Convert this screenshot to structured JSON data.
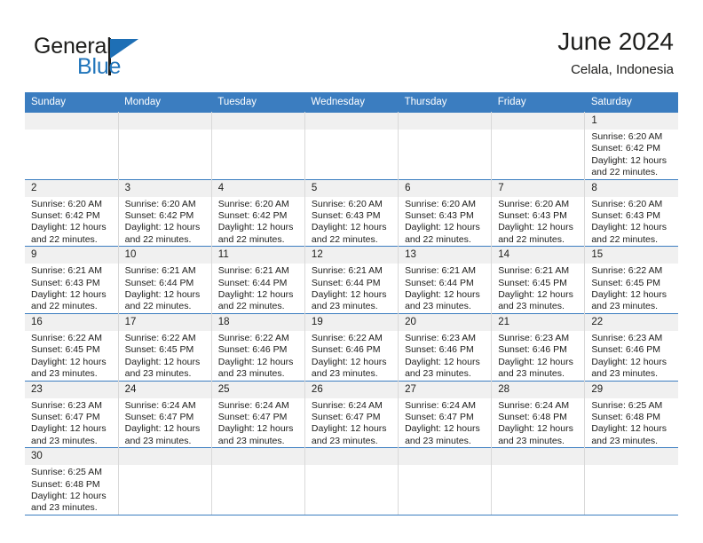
{
  "brand": {
    "name_top": "General",
    "name_bottom": "Blue",
    "accent_color": "#2175bb"
  },
  "header": {
    "title": "June 2024",
    "subtitle": "Celala, Indonesia"
  },
  "calendar": {
    "header_bg": "#3b7dc0",
    "daynum_bg": "#f0f0f0",
    "weekdays": [
      "Sunday",
      "Monday",
      "Tuesday",
      "Wednesday",
      "Thursday",
      "Friday",
      "Saturday"
    ],
    "labels": {
      "sunrise": "Sunrise:",
      "sunset": "Sunset:",
      "daylight": "Daylight:"
    },
    "weeks": [
      [
        {
          "day": ""
        },
        {
          "day": ""
        },
        {
          "day": ""
        },
        {
          "day": ""
        },
        {
          "day": ""
        },
        {
          "day": ""
        },
        {
          "day": "1",
          "sunrise": "Sunrise: 6:20 AM",
          "sunset": "Sunset: 6:42 PM",
          "daylight_1": "Daylight: 12 hours",
          "daylight_2": "and 22 minutes."
        }
      ],
      [
        {
          "day": "2",
          "sunrise": "Sunrise: 6:20 AM",
          "sunset": "Sunset: 6:42 PM",
          "daylight_1": "Daylight: 12 hours",
          "daylight_2": "and 22 minutes."
        },
        {
          "day": "3",
          "sunrise": "Sunrise: 6:20 AM",
          "sunset": "Sunset: 6:42 PM",
          "daylight_1": "Daylight: 12 hours",
          "daylight_2": "and 22 minutes."
        },
        {
          "day": "4",
          "sunrise": "Sunrise: 6:20 AM",
          "sunset": "Sunset: 6:42 PM",
          "daylight_1": "Daylight: 12 hours",
          "daylight_2": "and 22 minutes."
        },
        {
          "day": "5",
          "sunrise": "Sunrise: 6:20 AM",
          "sunset": "Sunset: 6:43 PM",
          "daylight_1": "Daylight: 12 hours",
          "daylight_2": "and 22 minutes."
        },
        {
          "day": "6",
          "sunrise": "Sunrise: 6:20 AM",
          "sunset": "Sunset: 6:43 PM",
          "daylight_1": "Daylight: 12 hours",
          "daylight_2": "and 22 minutes."
        },
        {
          "day": "7",
          "sunrise": "Sunrise: 6:20 AM",
          "sunset": "Sunset: 6:43 PM",
          "daylight_1": "Daylight: 12 hours",
          "daylight_2": "and 22 minutes."
        },
        {
          "day": "8",
          "sunrise": "Sunrise: 6:20 AM",
          "sunset": "Sunset: 6:43 PM",
          "daylight_1": "Daylight: 12 hours",
          "daylight_2": "and 22 minutes."
        }
      ],
      [
        {
          "day": "9",
          "sunrise": "Sunrise: 6:21 AM",
          "sunset": "Sunset: 6:43 PM",
          "daylight_1": "Daylight: 12 hours",
          "daylight_2": "and 22 minutes."
        },
        {
          "day": "10",
          "sunrise": "Sunrise: 6:21 AM",
          "sunset": "Sunset: 6:44 PM",
          "daylight_1": "Daylight: 12 hours",
          "daylight_2": "and 22 minutes."
        },
        {
          "day": "11",
          "sunrise": "Sunrise: 6:21 AM",
          "sunset": "Sunset: 6:44 PM",
          "daylight_1": "Daylight: 12 hours",
          "daylight_2": "and 22 minutes."
        },
        {
          "day": "12",
          "sunrise": "Sunrise: 6:21 AM",
          "sunset": "Sunset: 6:44 PM",
          "daylight_1": "Daylight: 12 hours",
          "daylight_2": "and 23 minutes."
        },
        {
          "day": "13",
          "sunrise": "Sunrise: 6:21 AM",
          "sunset": "Sunset: 6:44 PM",
          "daylight_1": "Daylight: 12 hours",
          "daylight_2": "and 23 minutes."
        },
        {
          "day": "14",
          "sunrise": "Sunrise: 6:21 AM",
          "sunset": "Sunset: 6:45 PM",
          "daylight_1": "Daylight: 12 hours",
          "daylight_2": "and 23 minutes."
        },
        {
          "day": "15",
          "sunrise": "Sunrise: 6:22 AM",
          "sunset": "Sunset: 6:45 PM",
          "daylight_1": "Daylight: 12 hours",
          "daylight_2": "and 23 minutes."
        }
      ],
      [
        {
          "day": "16",
          "sunrise": "Sunrise: 6:22 AM",
          "sunset": "Sunset: 6:45 PM",
          "daylight_1": "Daylight: 12 hours",
          "daylight_2": "and 23 minutes."
        },
        {
          "day": "17",
          "sunrise": "Sunrise: 6:22 AM",
          "sunset": "Sunset: 6:45 PM",
          "daylight_1": "Daylight: 12 hours",
          "daylight_2": "and 23 minutes."
        },
        {
          "day": "18",
          "sunrise": "Sunrise: 6:22 AM",
          "sunset": "Sunset: 6:46 PM",
          "daylight_1": "Daylight: 12 hours",
          "daylight_2": "and 23 minutes."
        },
        {
          "day": "19",
          "sunrise": "Sunrise: 6:22 AM",
          "sunset": "Sunset: 6:46 PM",
          "daylight_1": "Daylight: 12 hours",
          "daylight_2": "and 23 minutes."
        },
        {
          "day": "20",
          "sunrise": "Sunrise: 6:23 AM",
          "sunset": "Sunset: 6:46 PM",
          "daylight_1": "Daylight: 12 hours",
          "daylight_2": "and 23 minutes."
        },
        {
          "day": "21",
          "sunrise": "Sunrise: 6:23 AM",
          "sunset": "Sunset: 6:46 PM",
          "daylight_1": "Daylight: 12 hours",
          "daylight_2": "and 23 minutes."
        },
        {
          "day": "22",
          "sunrise": "Sunrise: 6:23 AM",
          "sunset": "Sunset: 6:46 PM",
          "daylight_1": "Daylight: 12 hours",
          "daylight_2": "and 23 minutes."
        }
      ],
      [
        {
          "day": "23",
          "sunrise": "Sunrise: 6:23 AM",
          "sunset": "Sunset: 6:47 PM",
          "daylight_1": "Daylight: 12 hours",
          "daylight_2": "and 23 minutes."
        },
        {
          "day": "24",
          "sunrise": "Sunrise: 6:24 AM",
          "sunset": "Sunset: 6:47 PM",
          "daylight_1": "Daylight: 12 hours",
          "daylight_2": "and 23 minutes."
        },
        {
          "day": "25",
          "sunrise": "Sunrise: 6:24 AM",
          "sunset": "Sunset: 6:47 PM",
          "daylight_1": "Daylight: 12 hours",
          "daylight_2": "and 23 minutes."
        },
        {
          "day": "26",
          "sunrise": "Sunrise: 6:24 AM",
          "sunset": "Sunset: 6:47 PM",
          "daylight_1": "Daylight: 12 hours",
          "daylight_2": "and 23 minutes."
        },
        {
          "day": "27",
          "sunrise": "Sunrise: 6:24 AM",
          "sunset": "Sunset: 6:47 PM",
          "daylight_1": "Daylight: 12 hours",
          "daylight_2": "and 23 minutes."
        },
        {
          "day": "28",
          "sunrise": "Sunrise: 6:24 AM",
          "sunset": "Sunset: 6:48 PM",
          "daylight_1": "Daylight: 12 hours",
          "daylight_2": "and 23 minutes."
        },
        {
          "day": "29",
          "sunrise": "Sunrise: 6:25 AM",
          "sunset": "Sunset: 6:48 PM",
          "daylight_1": "Daylight: 12 hours",
          "daylight_2": "and 23 minutes."
        }
      ],
      [
        {
          "day": "30",
          "sunrise": "Sunrise: 6:25 AM",
          "sunset": "Sunset: 6:48 PM",
          "daylight_1": "Daylight: 12 hours",
          "daylight_2": "and 23 minutes."
        },
        {
          "day": ""
        },
        {
          "day": ""
        },
        {
          "day": ""
        },
        {
          "day": ""
        },
        {
          "day": ""
        },
        {
          "day": ""
        }
      ]
    ]
  }
}
